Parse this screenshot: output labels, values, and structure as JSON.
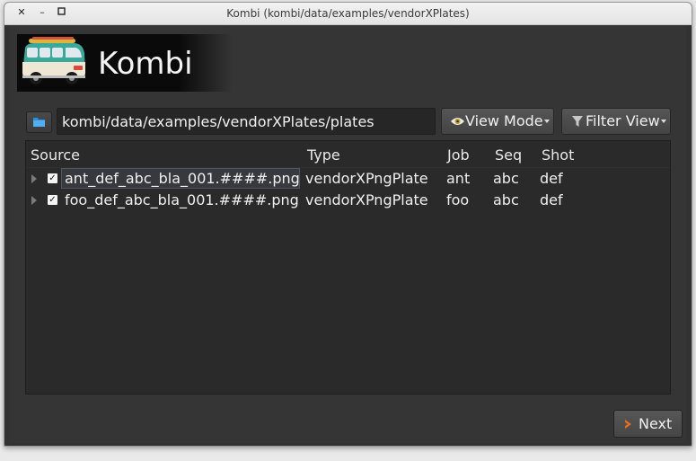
{
  "window": {
    "title": "Kombi (kombi/data/examples/vendorXPlates)",
    "close_glyph": "✕",
    "minimize_glyph": "–",
    "maximize_glyph": "▫"
  },
  "banner": {
    "title": "Kombi",
    "logo_icon": "van-icon"
  },
  "toolbar": {
    "folder_icon": "folder-icon",
    "path_value": "kombi/data/examples/vendorXPlates/plates",
    "view_mode_label": "View Mode",
    "view_mode_icon": "eye-icon",
    "filter_view_label": "Filter View",
    "filter_view_icon": "filter-icon"
  },
  "tree": {
    "columns": [
      "Source",
      "Type",
      "Job",
      "Seq",
      "Shot"
    ],
    "rows": [
      {
        "checked": true,
        "source": "ant_def_abc_bla_001.####.png",
        "type": "vendorXPngPlate",
        "job": "ant",
        "seq": "abc",
        "shot": "def",
        "selected": true
      },
      {
        "checked": true,
        "source": "foo_def_abc_bla_001.####.png",
        "type": "vendorXPngPlate",
        "job": "foo",
        "seq": "abc",
        "shot": "def",
        "selected": false
      }
    ]
  },
  "footer": {
    "next_label": "Next",
    "next_icon": "chevron-right-icon"
  },
  "colors": {
    "accent_orange": "#e07020",
    "folder_blue": "#2a8fe0"
  }
}
